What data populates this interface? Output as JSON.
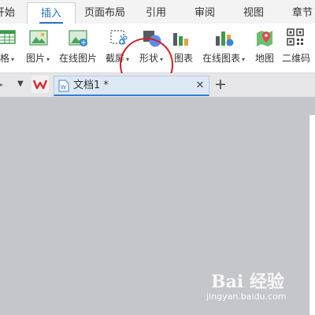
{
  "menu": {
    "tabs": [
      {
        "label": "开始"
      },
      {
        "label": "插入"
      },
      {
        "label": "页面布局"
      },
      {
        "label": "引用"
      },
      {
        "label": "审阅"
      },
      {
        "label": "视图"
      },
      {
        "label": "章节"
      }
    ],
    "active_index": 1
  },
  "ribbon": {
    "table_partial_label": "格",
    "items": [
      {
        "label": "图片",
        "icon": "picture-icon"
      },
      {
        "label": "在线图片",
        "icon": "online-picture-icon"
      },
      {
        "label": "截屏",
        "icon": "screenshot-icon"
      },
      {
        "label": "形状",
        "icon": "shapes-icon"
      },
      {
        "label": "图表",
        "icon": "chart-icon"
      },
      {
        "label": "在线图表",
        "icon": "online-chart-icon"
      },
      {
        "label": "地图",
        "icon": "map-icon"
      },
      {
        "label": "二维码",
        "icon": "qr-code-icon"
      }
    ]
  },
  "doc_tabs": {
    "active_title": "文档1 *"
  },
  "watermark": {
    "brand": "Bai 经验",
    "url": "jingyan.baidu.com"
  },
  "colors": {
    "accent": "#2a6fc9",
    "highlight": "#d21f24",
    "workspace": "#c5c6cc"
  }
}
